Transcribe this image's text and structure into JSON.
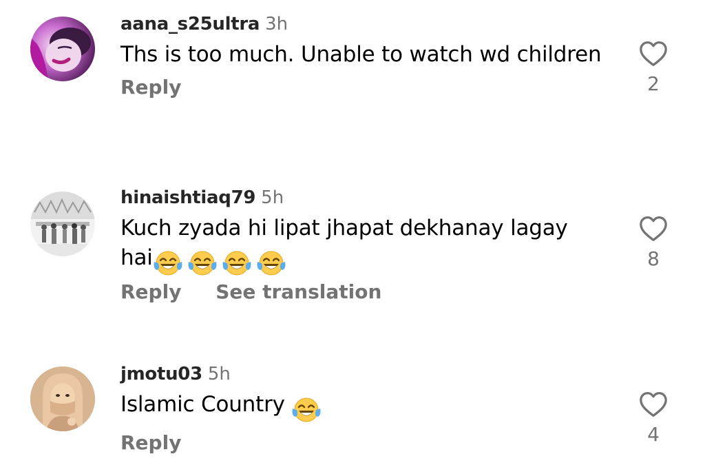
{
  "comments": [
    {
      "username": "aana_s25ultra",
      "time": "3h",
      "text": "Ths is too much. Unable to watch wd children",
      "emoji_count": 0,
      "reply_label": "Reply",
      "translation_label": "",
      "likes": "2",
      "avatar": "portrait-woman-purple"
    },
    {
      "username": "hinaishtiaq79",
      "time": "5h",
      "text": "Kuch zyada hi lipat jhapat dekhanay lagay hai",
      "emoji_count": 4,
      "reply_label": "Reply",
      "translation_label": "See translation",
      "likes": "8",
      "avatar": "group-photo-grayscale"
    },
    {
      "username": "jmotu03",
      "time": "5h",
      "text": "Islamic Country",
      "emoji_count": 1,
      "reply_label": "Reply",
      "translation_label": "",
      "likes": "4",
      "avatar": "woman-niqab-illustration"
    }
  ],
  "icons": {
    "like": "heart-outline-icon",
    "emoji": "face-with-tears-of-joy"
  },
  "colors": {
    "text": "#000000",
    "username": "#262626",
    "muted": "#737373",
    "background": "#ffffff",
    "emoji_face": "#FFCC4D",
    "emoji_tear": "#5DADEC"
  }
}
